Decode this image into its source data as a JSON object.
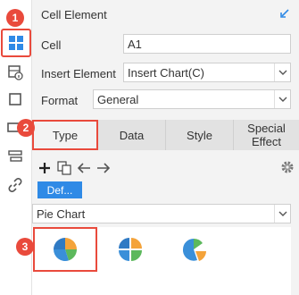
{
  "sidebar": {
    "items": [
      {
        "icon": "cell-grid-icon",
        "active": true
      },
      {
        "icon": "cell-info-icon"
      },
      {
        "icon": "square-icon"
      },
      {
        "icon": "widget-icon"
      },
      {
        "icon": "stack-icon"
      },
      {
        "icon": "link-icon"
      }
    ]
  },
  "header": {
    "title": "Cell Element"
  },
  "form": {
    "cell_label": "Cell",
    "cell_value": "A1",
    "insert_label": "Insert Element",
    "insert_value": "Insert Chart(C)",
    "format_label": "Format",
    "format_value": "General"
  },
  "tabs": [
    {
      "label": "Type",
      "active": true
    },
    {
      "label": "Data"
    },
    {
      "label": "Style"
    },
    {
      "label": "Special Effect"
    }
  ],
  "toolbar": {
    "tools": [
      "add-icon",
      "copy-icon",
      "arrow-left-icon",
      "arrow-right-icon"
    ],
    "settings_icon": "gear-icon"
  },
  "series_button": {
    "label": "Def..."
  },
  "chart_type": {
    "value": "Pie Chart"
  },
  "gallery": [
    {
      "name": "pie-chart",
      "active": true
    },
    {
      "name": "pie-chart-variant-2"
    },
    {
      "name": "pie-chart-variant-3"
    }
  ],
  "badges": {
    "b1": "1",
    "b2": "2",
    "b3": "3"
  },
  "colors": {
    "accent_red": "#e94a3c",
    "blue": "#2f8ae6",
    "panel_bg": "#f3f3f3",
    "tab_bg": "#e2e2e2"
  }
}
